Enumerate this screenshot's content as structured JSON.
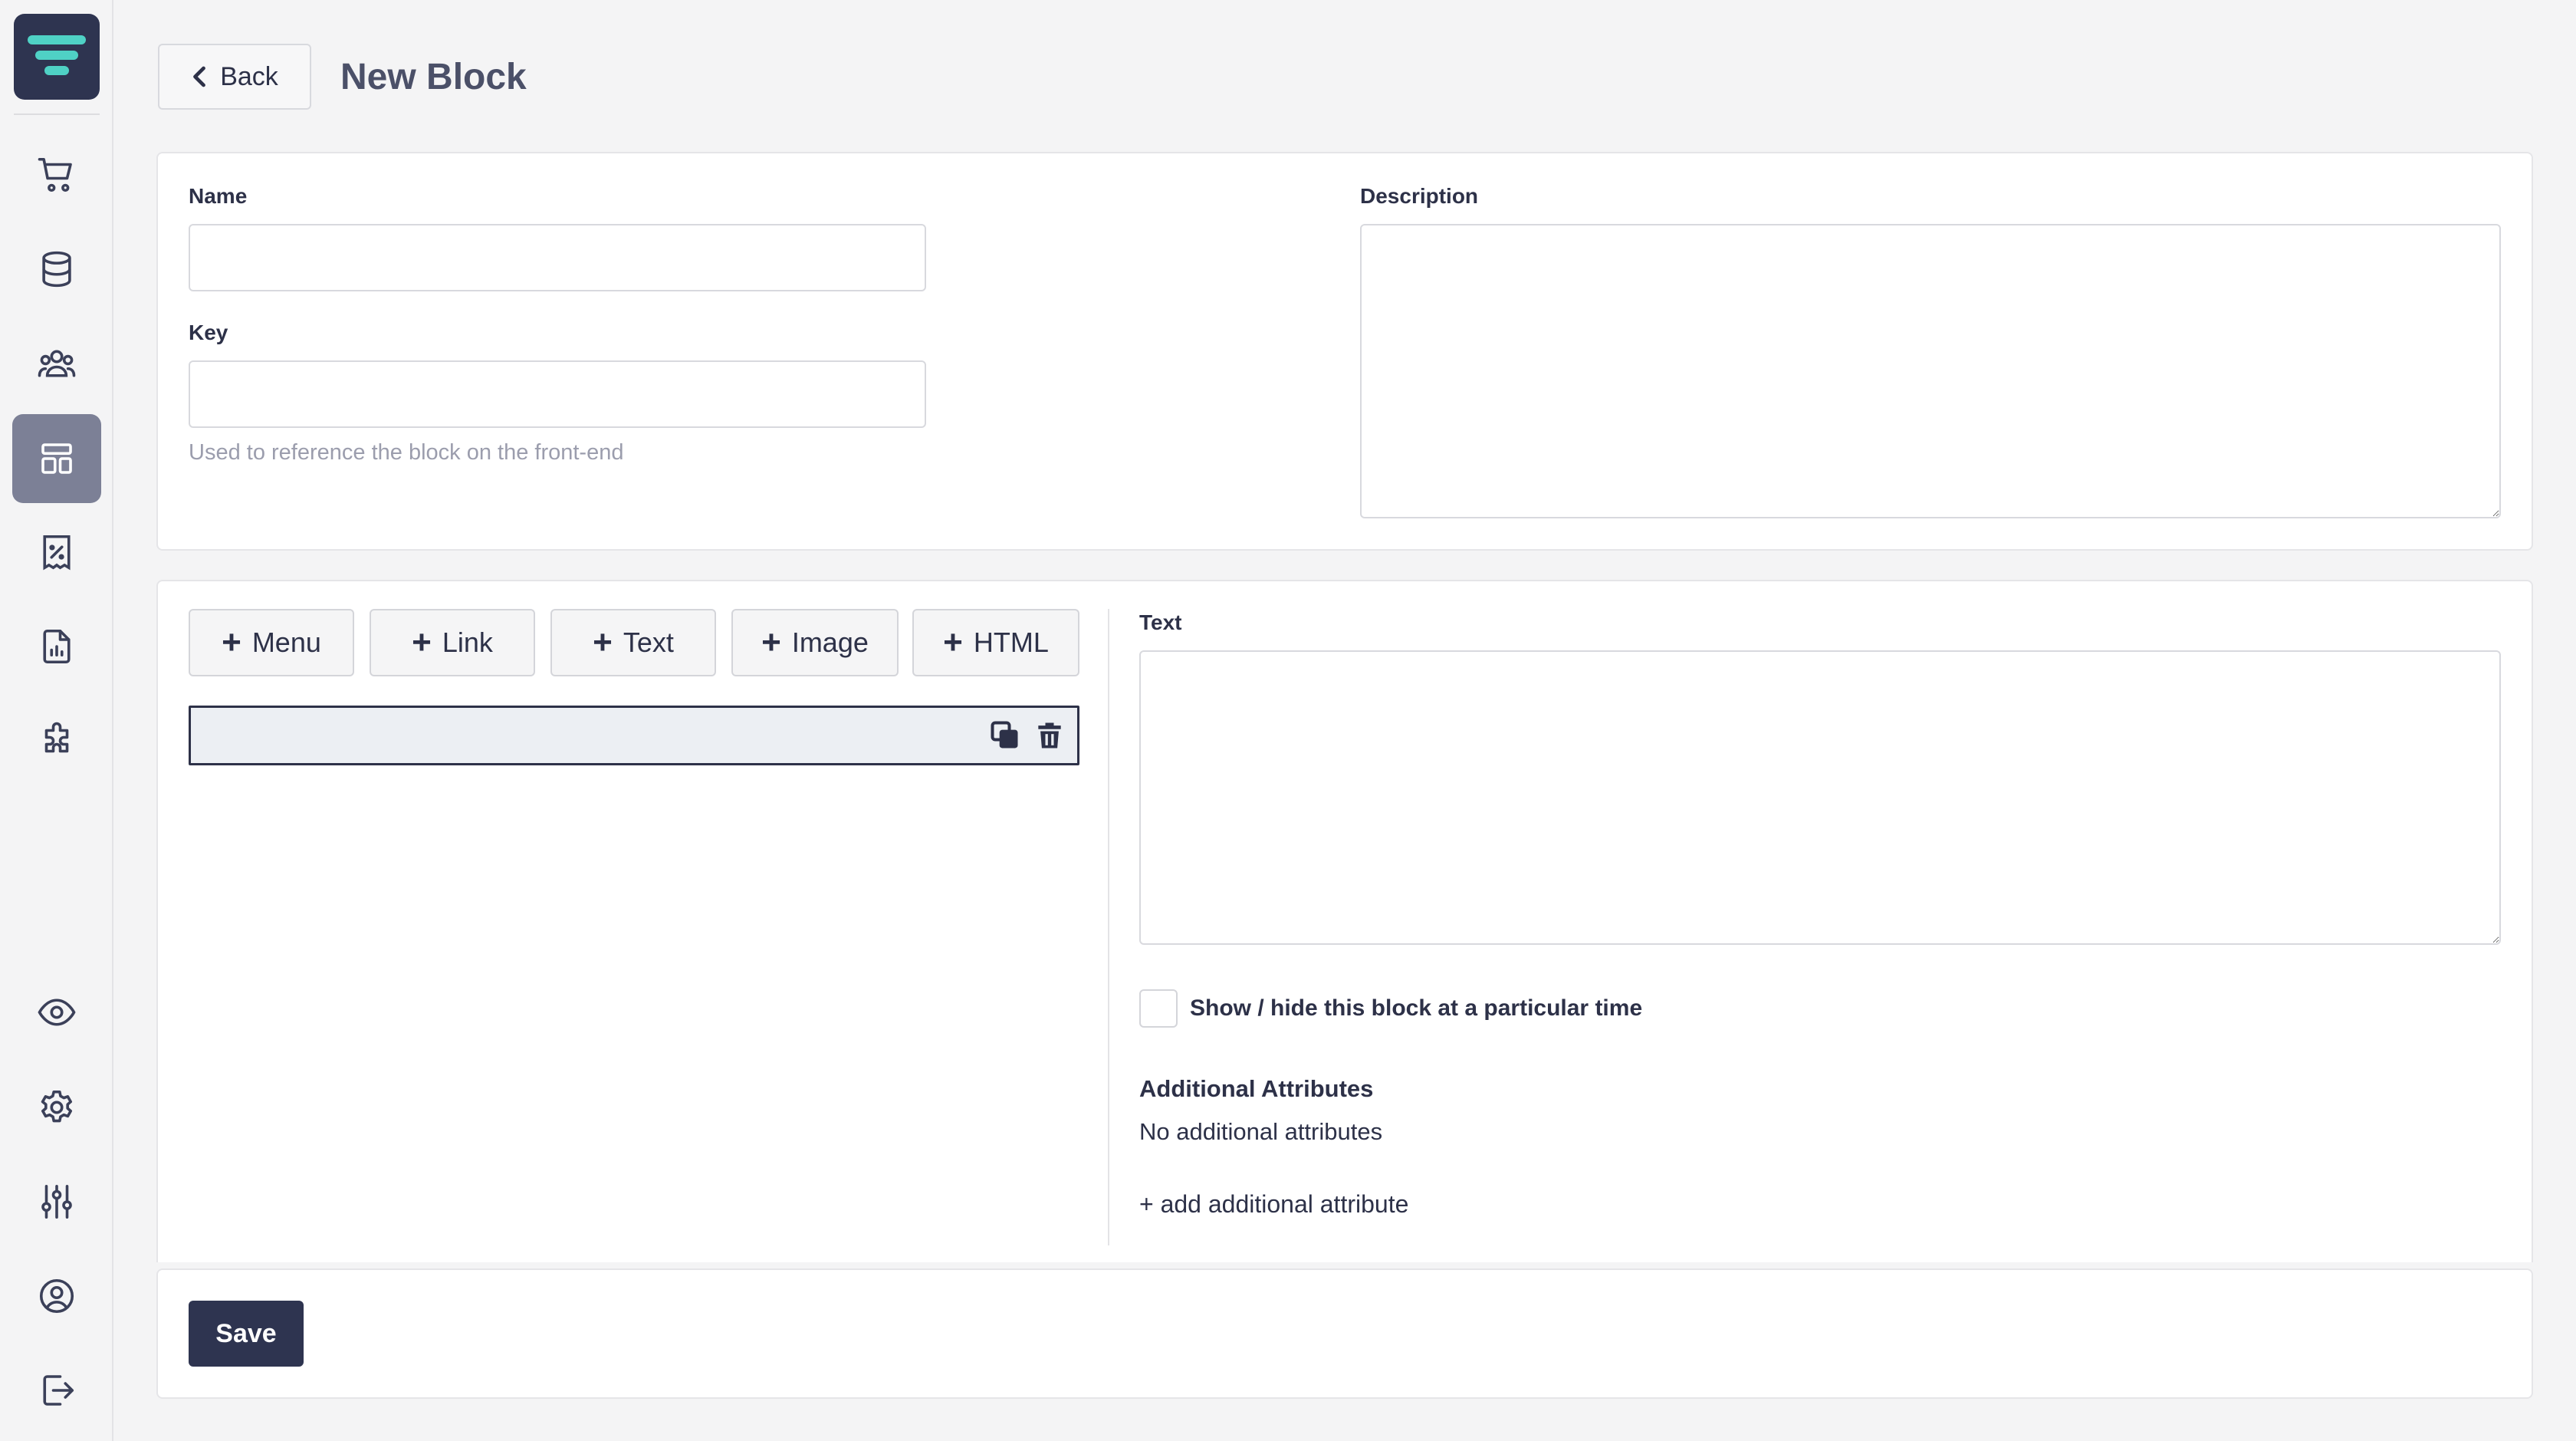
{
  "app": {
    "logo_icon": "logo-icon",
    "accent": "#4fd1c5",
    "brand": "#2e3450"
  },
  "sidebar": {
    "top_items": [
      {
        "name": "cart",
        "icon": "cart-icon"
      },
      {
        "name": "database",
        "icon": "database-icon"
      },
      {
        "name": "users",
        "icon": "users-icon"
      },
      {
        "name": "layout",
        "icon": "layout-icon",
        "active": true
      },
      {
        "name": "discount",
        "icon": "receipt-percent-icon"
      },
      {
        "name": "reports",
        "icon": "report-chart-icon"
      },
      {
        "name": "extensions",
        "icon": "puzzle-icon"
      }
    ],
    "bottom_items": [
      {
        "name": "preview",
        "icon": "eye-icon"
      },
      {
        "name": "settings",
        "icon": "gear-icon"
      },
      {
        "name": "adjustments",
        "icon": "sliders-icon"
      },
      {
        "name": "account",
        "icon": "user-circle-icon"
      },
      {
        "name": "logout",
        "icon": "logout-icon"
      }
    ]
  },
  "header": {
    "back_label": "Back",
    "title": "New Block"
  },
  "form": {
    "name_label": "Name",
    "name_value": "",
    "key_label": "Key",
    "key_value": "",
    "key_hint": "Used to reference the block on the front-end",
    "description_label": "Description",
    "description_value": ""
  },
  "builder": {
    "buttons": [
      {
        "label": "Menu"
      },
      {
        "label": "Link"
      },
      {
        "label": "Text"
      },
      {
        "label": "Image"
      },
      {
        "label": "HTML"
      }
    ],
    "text_label": "Text",
    "text_value": "",
    "schedule_label": "Show / hide this block at a particular time",
    "schedule_checked": false,
    "attributes_title": "Additional Attributes",
    "attributes_empty": "No additional attributes",
    "add_attribute": "+ add additional attribute"
  },
  "footer": {
    "save_label": "Save"
  }
}
